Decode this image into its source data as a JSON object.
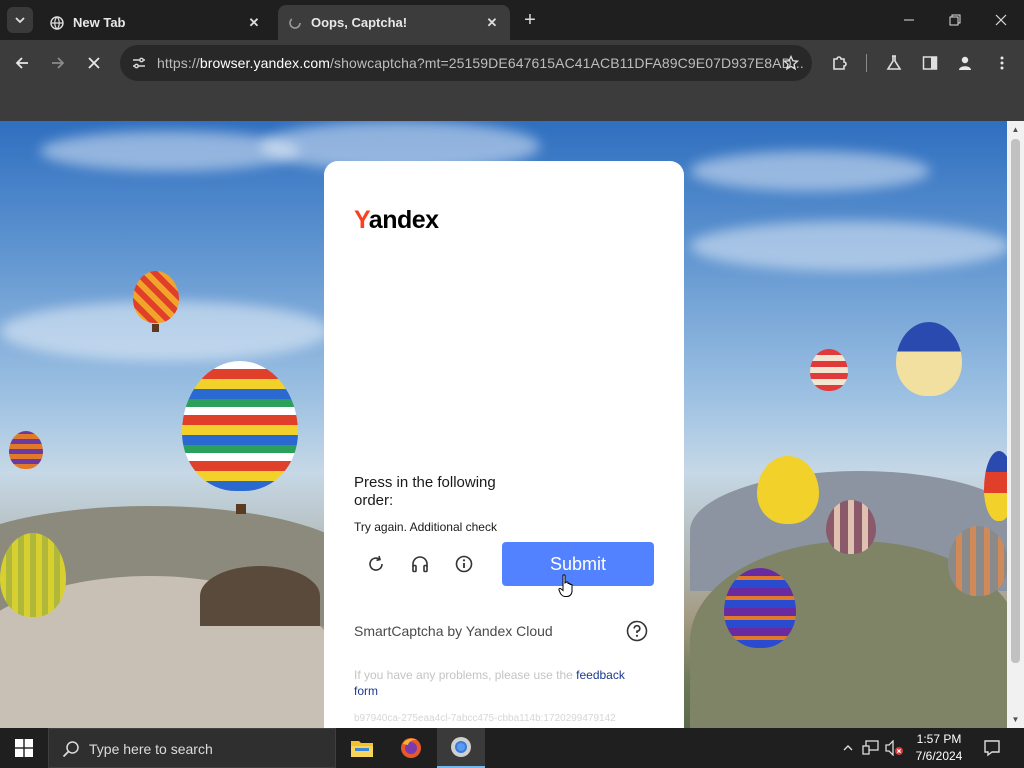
{
  "browser": {
    "tabs": [
      {
        "title": "New Tab",
        "active": false
      },
      {
        "title": "Oops, Captcha!",
        "active": true
      }
    ],
    "url": {
      "scheme": "https://",
      "host": "browser.yandex.com",
      "path": "/showcaptcha?mt=25159DE647615AC41ACB11DFA89C9E07D937E8AD..."
    },
    "loading": true
  },
  "captcha": {
    "logo_first": "Y",
    "logo_rest": "andex",
    "instruction": "Press in the following order:",
    "error_text": "Try again. Additional check",
    "submit_label": "Submit",
    "brand_text": "SmartCaptcha by Yandex Cloud",
    "feedback_prefix": "If you have any problems, please use the",
    "feedback_link": "feedback form",
    "request_id": "b97940ca-275eaa4cl-7abcc475-cbba114b:1720299479142"
  },
  "taskbar": {
    "search_placeholder": "Type here to search",
    "time": "1:57 PM",
    "date": "7/6/2024"
  },
  "colors": {
    "yandex_red": "#fc3f1d",
    "submit_blue": "#5282ff",
    "link_blue": "#1b3a8c"
  }
}
